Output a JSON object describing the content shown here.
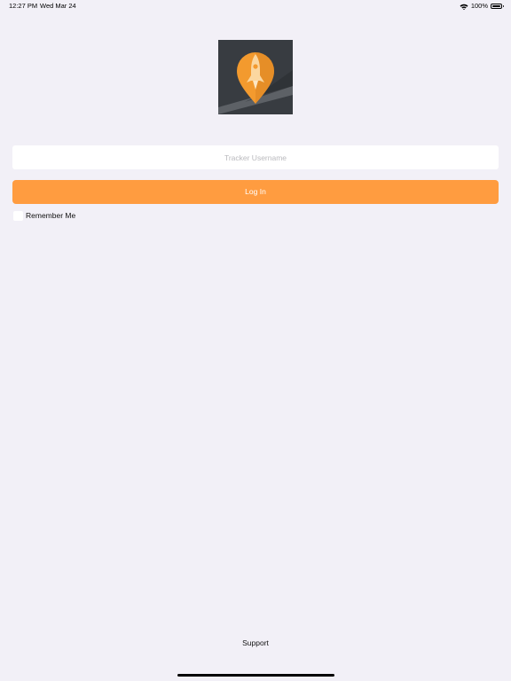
{
  "status_bar": {
    "time": "12:27 PM",
    "date": "Wed Mar 24",
    "battery": "100%"
  },
  "logo": {
    "icon": "rocket-location-pin-icon",
    "background": "#383c41",
    "accent": "#f5a23c"
  },
  "login_form": {
    "username_placeholder": "Tracker Username",
    "username_value": "",
    "login_label": "Log In",
    "remember_label": "Remember Me"
  },
  "footer": {
    "support_label": "Support"
  },
  "colors": {
    "page_background": "#f2f0f7",
    "primary_button": "#ff9c40"
  }
}
